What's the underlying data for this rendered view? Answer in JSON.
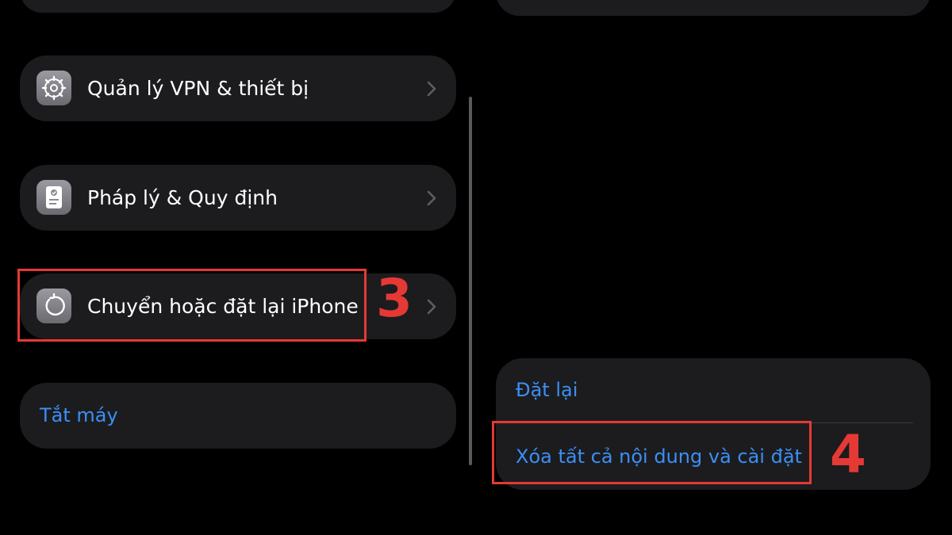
{
  "left_panel": {
    "rows": [
      {
        "label": "Quản lý VPN & thiết bị",
        "icon": "gear-icon"
      },
      {
        "label": "Pháp lý & Quy định",
        "icon": "legal-document-icon"
      },
      {
        "label": "Chuyển hoặc đặt lại iPhone",
        "icon": "reset-icon"
      }
    ],
    "shutdown_label": "Tắt máy"
  },
  "right_panel": {
    "reset_label": "Đặt lại",
    "erase_label": "Xóa tất cả nội dung và cài đặt"
  },
  "annotations": {
    "step3": "3",
    "step4": "4"
  },
  "colors": {
    "background": "#000000",
    "card": "#1c1c1e",
    "link_blue": "#3b8ff6",
    "highlight_red": "#e53935"
  }
}
